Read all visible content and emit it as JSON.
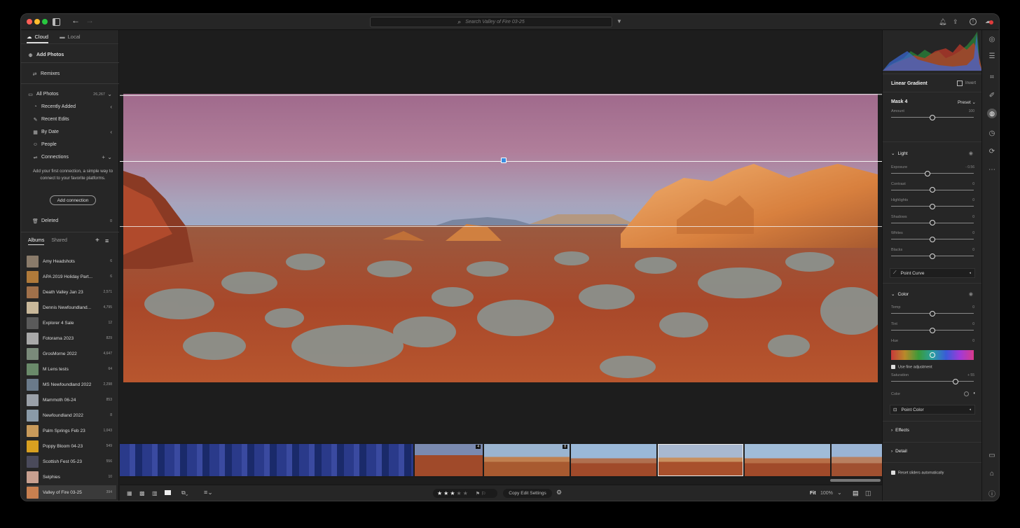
{
  "titlebar": {
    "search_placeholder": "Search Valley of Fire 03-25"
  },
  "left": {
    "tabs": [
      {
        "label": "Cloud"
      },
      {
        "label": "Local"
      }
    ],
    "add_photos": "Add Photos",
    "remixes": "Remixes",
    "all_photos": {
      "label": "All Photos",
      "count": "26,267"
    },
    "nav": [
      "Recently Added",
      "Recent Edits",
      "By Date",
      "People"
    ],
    "connections": "Connections",
    "connection_msg": "Add your first connection, a simple way to connect to your favorite platforms.",
    "add_connection": "Add connection",
    "deleted": {
      "label": "Deleted",
      "count": "0"
    },
    "album_tabs": [
      "Albums",
      "Shared"
    ],
    "albums": [
      {
        "name": "Amy Headshots",
        "count": "6",
        "color": "#8a7b6a"
      },
      {
        "name": "APA 2019 Holiday Part...",
        "count": "6",
        "color": "#b07a3a"
      },
      {
        "name": "Death Valley Jan 23",
        "count": "2,571",
        "color": "#a0704a"
      },
      {
        "name": "Dennis Newfoundland...",
        "count": "4,795",
        "color": "#c9b89a"
      },
      {
        "name": "Explorer 4 Sale",
        "count": "12",
        "color": "#5a5a5a"
      },
      {
        "name": "Fotorama 2023",
        "count": "829",
        "color": "#a8a8a8"
      },
      {
        "name": "GrosMorne 2022",
        "count": "4,647",
        "color": "#7a8a7a"
      },
      {
        "name": "M Lens tests",
        "count": "64",
        "color": "#6a8a6a"
      },
      {
        "name": "MS Newfoundland 2022",
        "count": "2,298",
        "color": "#6a7a8a"
      },
      {
        "name": "Mammoth 06-24",
        "count": "853",
        "color": "#9aa0a8"
      },
      {
        "name": "Newfoundland 2022",
        "count": "8",
        "color": "#8a9aa8"
      },
      {
        "name": "Palm Springs Feb 23",
        "count": "1,043",
        "color": "#c89a5a"
      },
      {
        "name": "Poppy Bloom 04-23",
        "count": "549",
        "color": "#d8a020"
      },
      {
        "name": "Scottish Fest 05-23",
        "count": "556",
        "color": "#4a4a5a"
      },
      {
        "name": "Selphies",
        "count": "10",
        "color": "#c8a090"
      },
      {
        "name": "Valley of Fire 03-25",
        "count": "394",
        "color": "#c88050"
      }
    ]
  },
  "right": {
    "panel_title": "Linear Gradient",
    "invert": "Invert",
    "mask_name": "Mask 4",
    "preset": "Preset",
    "amount": {
      "label": "Amount",
      "value": "100",
      "pos": 0.5
    },
    "light": {
      "title": "Light",
      "sliders": [
        {
          "label": "Exposure",
          "value": "- 0.56",
          "pos": 0.44
        },
        {
          "label": "Contrast",
          "value": "0",
          "pos": 0.5
        },
        {
          "label": "Highlights",
          "value": "0",
          "pos": 0.5
        },
        {
          "label": "Shadows",
          "value": "0",
          "pos": 0.5
        },
        {
          "label": "Whites",
          "value": "0",
          "pos": 0.5
        },
        {
          "label": "Blacks",
          "value": "0",
          "pos": 0.5
        }
      ],
      "point_curve": "Point Curve"
    },
    "color": {
      "title": "Color",
      "temp": {
        "label": "Temp",
        "value": "0",
        "pos": 0.5
      },
      "tint": {
        "label": "Tint",
        "value": "0",
        "pos": 0.5
      },
      "hue": {
        "label": "Hue",
        "value": "0",
        "pos": 0.5
      },
      "fine": "Use fine adjustment",
      "saturation": {
        "label": "Saturation",
        "value": "+ 55",
        "pos": 0.78
      },
      "color_label": "Color",
      "point_color": "Point Color"
    },
    "effects": "Effects",
    "detail": "Detail",
    "reset_auto": "Reset sliders automatically"
  },
  "bottombar": {
    "copy_edit": "Copy Edit Settings",
    "fit": "Fit",
    "zoom": "100%",
    "rating": 3,
    "rating_max": 5
  },
  "filmstrip": {
    "badges": [
      "4",
      "8"
    ]
  }
}
